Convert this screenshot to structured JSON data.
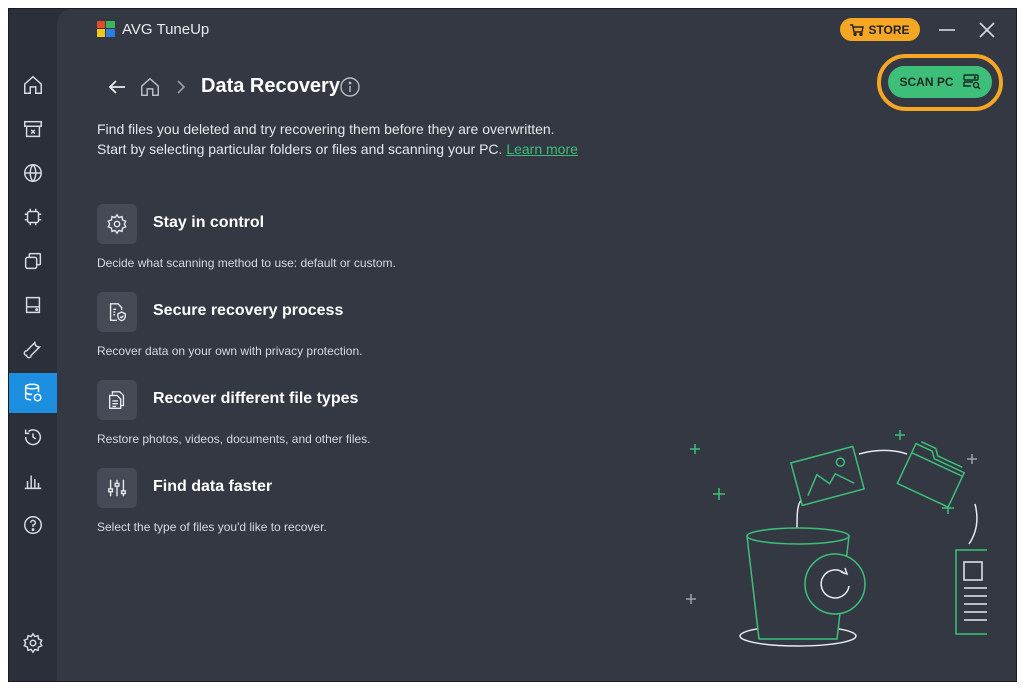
{
  "app": {
    "title": "AVG TuneUp"
  },
  "titlebar": {
    "store_label": "STORE"
  },
  "header": {
    "title": "Data Recovery",
    "scan_label": "SCAN PC"
  },
  "intro": {
    "line1": "Find files you deleted and try recovering them before they are overwritten.",
    "line2": "Start by selecting particular folders or files and scanning your PC.",
    "learn_more": "Learn more"
  },
  "features": [
    {
      "title": "Stay in control",
      "desc": "Decide what scanning method to use: default or custom.",
      "icon": "gear-icon"
    },
    {
      "title": "Secure recovery process",
      "desc": "Recover data on your own with privacy protection.",
      "icon": "shield-document-icon"
    },
    {
      "title": "Recover different file types",
      "desc": "Restore photos, videos, documents, and other files.",
      "icon": "files-icon"
    },
    {
      "title": "Find data faster",
      "desc": "Select the type of files you'd like to recover.",
      "icon": "sliders-icon"
    }
  ],
  "sidebar": {
    "items": [
      "home-icon",
      "archive-icon",
      "globe-icon",
      "chip-icon",
      "windows-icon",
      "drive-icon",
      "wrench-icon",
      "data-recovery-icon",
      "history-icon",
      "chart-icon",
      "help-icon"
    ],
    "active": "data-recovery-icon",
    "bottom": "settings-icon"
  },
  "colors": {
    "accent_green": "#3dbf7a",
    "store_orange": "#f5a623",
    "active_blue": "#1d8fe0",
    "background": "#333843"
  }
}
